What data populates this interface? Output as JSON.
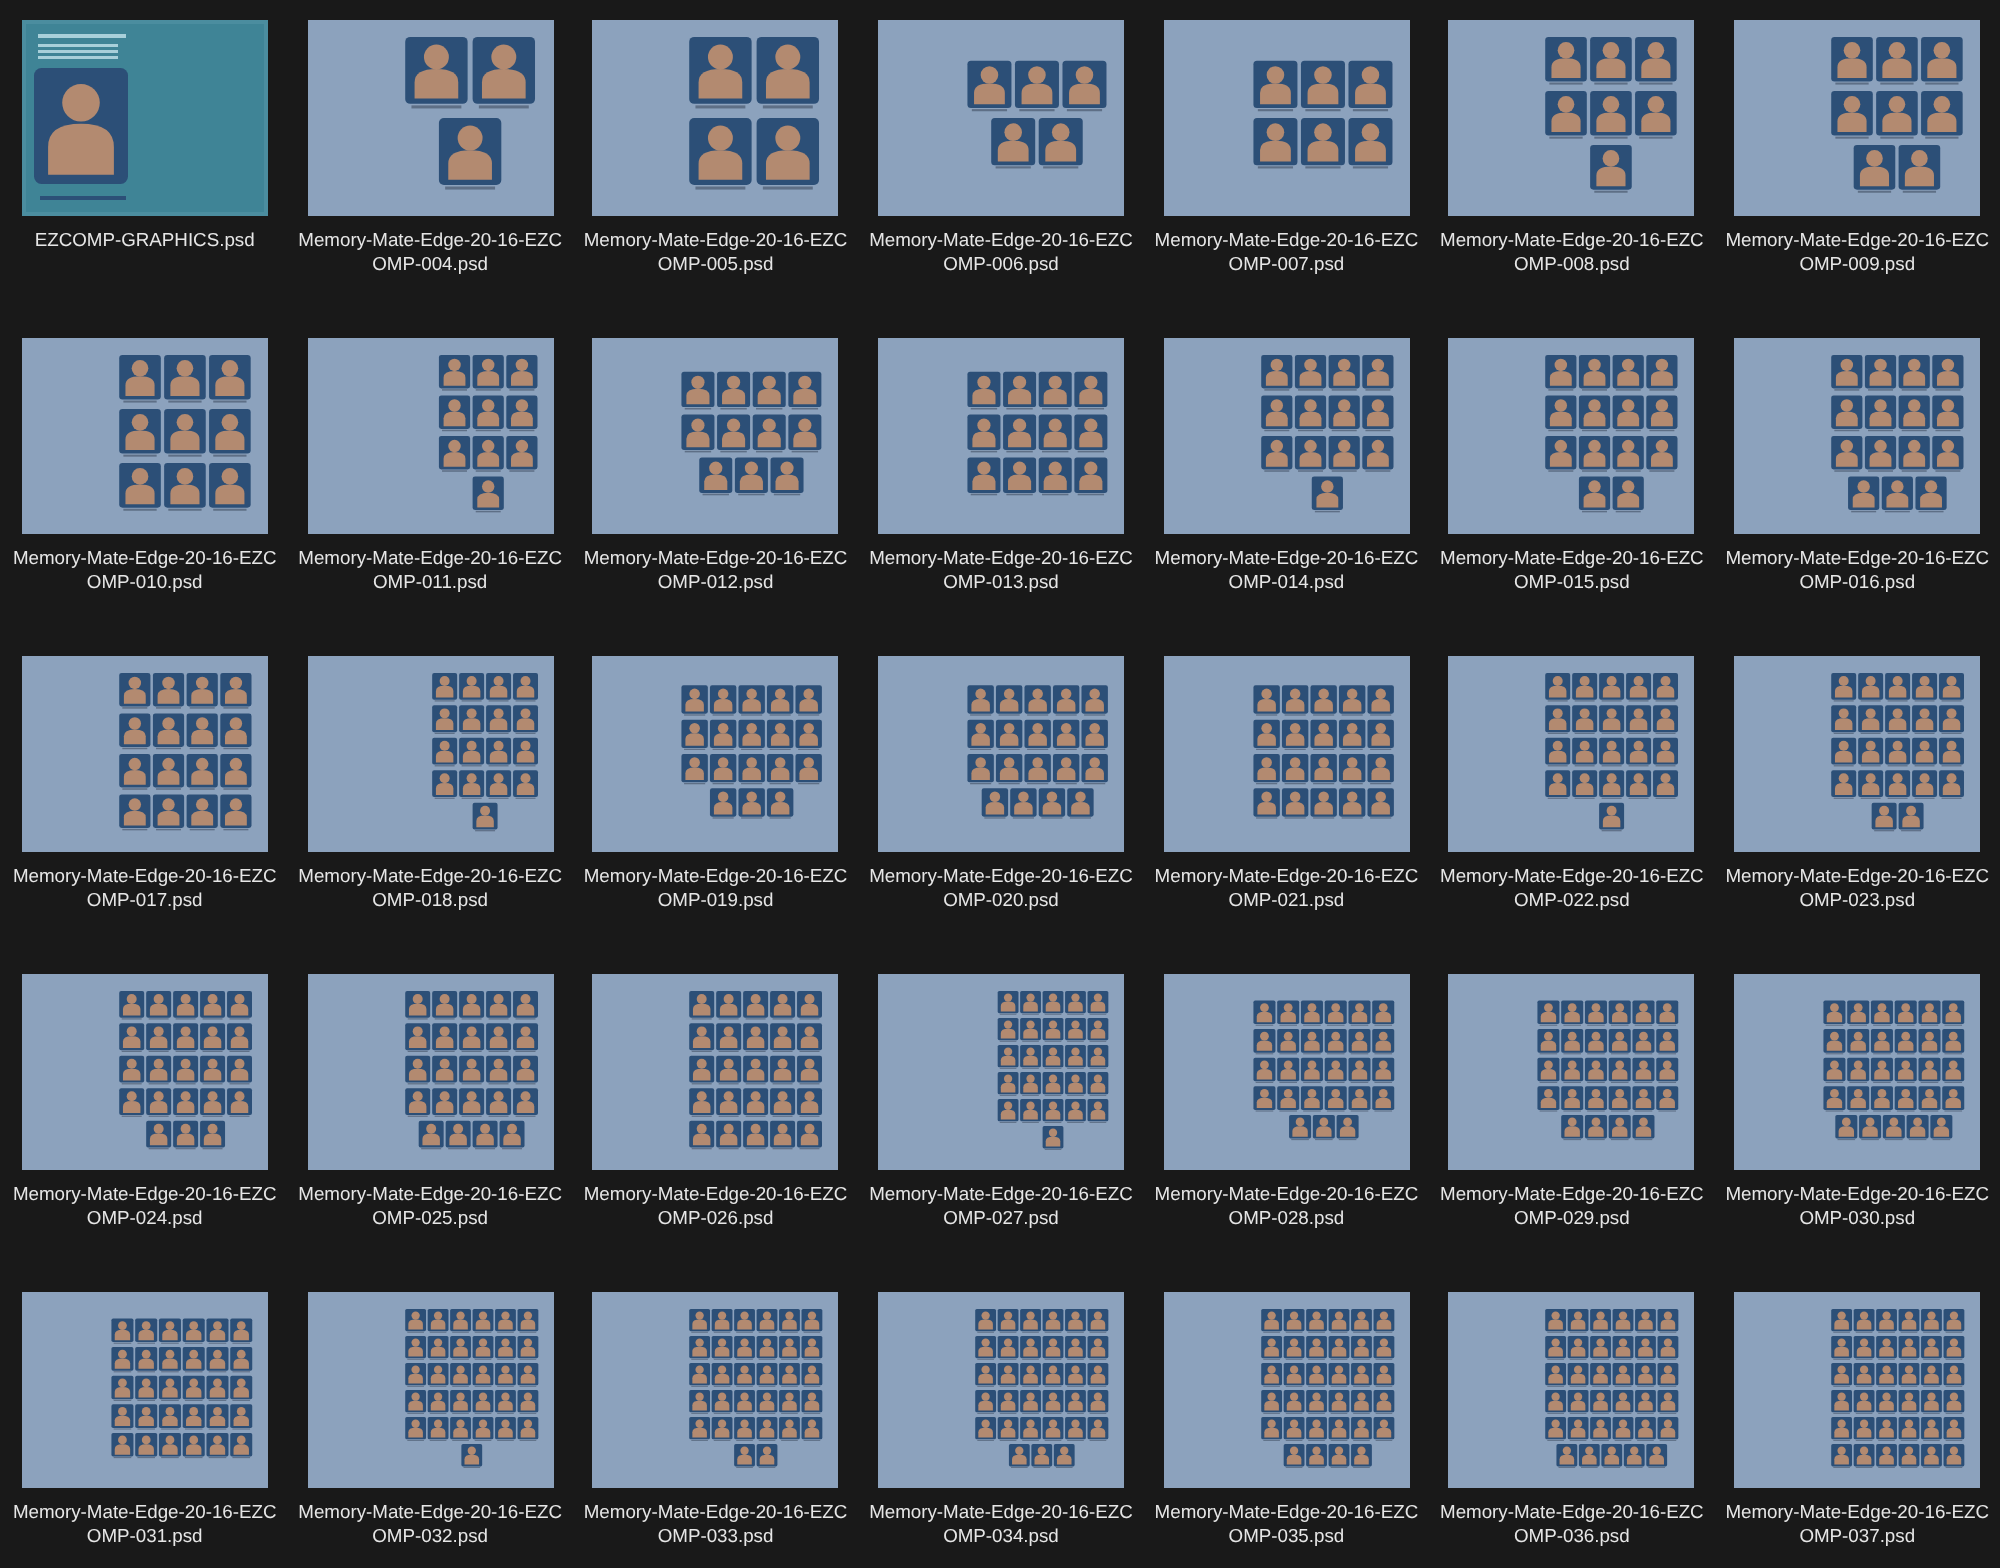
{
  "files": [
    {
      "kind": "graphics",
      "name_lines": [
        "EZCOMP-GRAPHICS.psd"
      ]
    },
    {
      "kind": "layout",
      "name_lines": [
        "Memory-Mate-Edge-20-16-EZC",
        "OMP-004.psd"
      ]
    },
    {
      "kind": "layout",
      "name_lines": [
        "Memory-Mate-Edge-20-16-EZC",
        "OMP-005.psd"
      ]
    },
    {
      "kind": "layout",
      "name_lines": [
        "Memory-Mate-Edge-20-16-EZC",
        "OMP-006.psd"
      ]
    },
    {
      "kind": "layout",
      "name_lines": [
        "Memory-Mate-Edge-20-16-EZC",
        "OMP-007.psd"
      ]
    },
    {
      "kind": "layout",
      "name_lines": [
        "Memory-Mate-Edge-20-16-EZC",
        "OMP-008.psd"
      ]
    },
    {
      "kind": "layout",
      "name_lines": [
        "Memory-Mate-Edge-20-16-EZC",
        "OMP-009.psd"
      ]
    },
    {
      "kind": "layout",
      "name_lines": [
        "Memory-Mate-Edge-20-16-EZC",
        "OMP-010.psd"
      ]
    },
    {
      "kind": "layout",
      "name_lines": [
        "Memory-Mate-Edge-20-16-EZC",
        "OMP-011.psd"
      ]
    },
    {
      "kind": "layout",
      "name_lines": [
        "Memory-Mate-Edge-20-16-EZC",
        "OMP-012.psd"
      ]
    },
    {
      "kind": "layout",
      "name_lines": [
        "Memory-Mate-Edge-20-16-EZC",
        "OMP-013.psd"
      ]
    },
    {
      "kind": "layout",
      "name_lines": [
        "Memory-Mate-Edge-20-16-EZC",
        "OMP-014.psd"
      ]
    },
    {
      "kind": "layout",
      "name_lines": [
        "Memory-Mate-Edge-20-16-EZC",
        "OMP-015.psd"
      ]
    },
    {
      "kind": "layout",
      "name_lines": [
        "Memory-Mate-Edge-20-16-EZC",
        "OMP-016.psd"
      ]
    },
    {
      "kind": "layout",
      "name_lines": [
        "Memory-Mate-Edge-20-16-EZC",
        "OMP-017.psd"
      ]
    },
    {
      "kind": "layout",
      "name_lines": [
        "Memory-Mate-Edge-20-16-EZC",
        "OMP-018.psd"
      ]
    },
    {
      "kind": "layout",
      "name_lines": [
        "Memory-Mate-Edge-20-16-EZC",
        "OMP-019.psd"
      ]
    },
    {
      "kind": "layout",
      "name_lines": [
        "Memory-Mate-Edge-20-16-EZC",
        "OMP-020.psd"
      ]
    },
    {
      "kind": "layout",
      "name_lines": [
        "Memory-Mate-Edge-20-16-EZC",
        "OMP-021.psd"
      ]
    },
    {
      "kind": "layout",
      "name_lines": [
        "Memory-Mate-Edge-20-16-EZC",
        "OMP-022.psd"
      ]
    },
    {
      "kind": "layout",
      "name_lines": [
        "Memory-Mate-Edge-20-16-EZC",
        "OMP-023.psd"
      ]
    },
    {
      "kind": "layout",
      "name_lines": [
        "Memory-Mate-Edge-20-16-EZC",
        "OMP-024.psd"
      ]
    },
    {
      "kind": "layout",
      "name_lines": [
        "Memory-Mate-Edge-20-16-EZC",
        "OMP-025.psd"
      ]
    },
    {
      "kind": "layout",
      "name_lines": [
        "Memory-Mate-Edge-20-16-EZC",
        "OMP-026.psd"
      ]
    },
    {
      "kind": "layout",
      "name_lines": [
        "Memory-Mate-Edge-20-16-EZC",
        "OMP-027.psd"
      ]
    },
    {
      "kind": "layout",
      "name_lines": [
        "Memory-Mate-Edge-20-16-EZC",
        "OMP-028.psd"
      ]
    },
    {
      "kind": "layout",
      "name_lines": [
        "Memory-Mate-Edge-20-16-EZC",
        "OMP-029.psd"
      ]
    },
    {
      "kind": "layout",
      "name_lines": [
        "Memory-Mate-Edge-20-16-EZC",
        "OMP-030.psd"
      ]
    },
    {
      "kind": "layout",
      "name_lines": [
        "Memory-Mate-Edge-20-16-EZC",
        "OMP-031.psd"
      ]
    },
    {
      "kind": "layout",
      "name_lines": [
        "Memory-Mate-Edge-20-16-EZC",
        "OMP-032.psd"
      ]
    },
    {
      "kind": "layout",
      "name_lines": [
        "Memory-Mate-Edge-20-16-EZC",
        "OMP-033.psd"
      ]
    },
    {
      "kind": "layout",
      "name_lines": [
        "Memory-Mate-Edge-20-16-EZC",
        "OMP-034.psd"
      ]
    },
    {
      "kind": "layout",
      "name_lines": [
        "Memory-Mate-Edge-20-16-EZC",
        "OMP-035.psd"
      ]
    },
    {
      "kind": "layout",
      "name_lines": [
        "Memory-Mate-Edge-20-16-EZC",
        "OMP-036.psd"
      ]
    },
    {
      "kind": "layout",
      "name_lines": [
        "Memory-Mate-Edge-20-16-EZC",
        "OMP-037.psd"
      ]
    }
  ]
}
